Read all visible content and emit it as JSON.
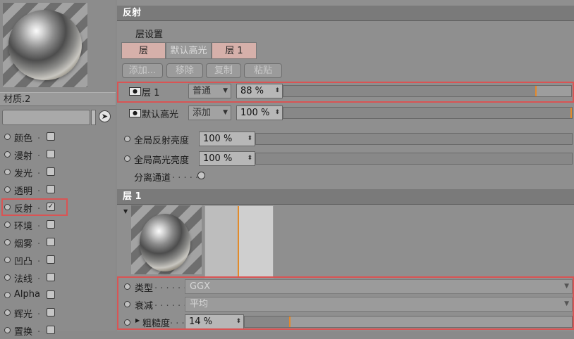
{
  "material": {
    "name": "材质.2"
  },
  "channels": [
    {
      "label": "颜色",
      "checked": false
    },
    {
      "label": "漫射",
      "checked": false
    },
    {
      "label": "发光",
      "checked": false
    },
    {
      "label": "透明",
      "checked": false
    },
    {
      "label": "反射",
      "checked": true
    },
    {
      "label": "环境",
      "checked": false
    },
    {
      "label": "烟雾",
      "checked": false
    },
    {
      "label": "凹凸",
      "checked": false
    },
    {
      "label": "法线",
      "checked": false
    },
    {
      "label": "Alpha",
      "checked": false
    },
    {
      "label": "辉光",
      "checked": false
    },
    {
      "label": "置换",
      "checked": false
    }
  ],
  "reflect": {
    "title": "反射",
    "layer_settings": "层设置",
    "tabs": [
      "层",
      "默认高光",
      "层 1"
    ],
    "buttons": [
      "添加...",
      "移除",
      "复制",
      "粘贴"
    ],
    "layers": [
      {
        "name": "层 1",
        "mode": "普通",
        "value": "88 %",
        "fraction": 0.88
      },
      {
        "name": "默认高光",
        "mode": "添加",
        "value": "100 %",
        "fraction": 1.0
      }
    ],
    "global_reflection": {
      "label": "全局反射亮度",
      "value": "100 %"
    },
    "global_specular": {
      "label": "全局高光亮度",
      "value": "100 %"
    },
    "separate": {
      "label": "分离通道",
      "dots": ". . . . ."
    }
  },
  "layer1": {
    "title": "层 1",
    "type": {
      "label": "类型",
      "dots": ". . . . . . .",
      "value": "GGX"
    },
    "attenuation": {
      "label": "衰减",
      "dots": ". . . . . . .",
      "value": "平均"
    },
    "roughness": {
      "label": "粗糙度",
      "dots": ". . . .",
      "value": "14 %",
      "fraction": 0.14
    }
  },
  "colors": {
    "accent": "#e4892a",
    "highlight": "#d95454"
  }
}
